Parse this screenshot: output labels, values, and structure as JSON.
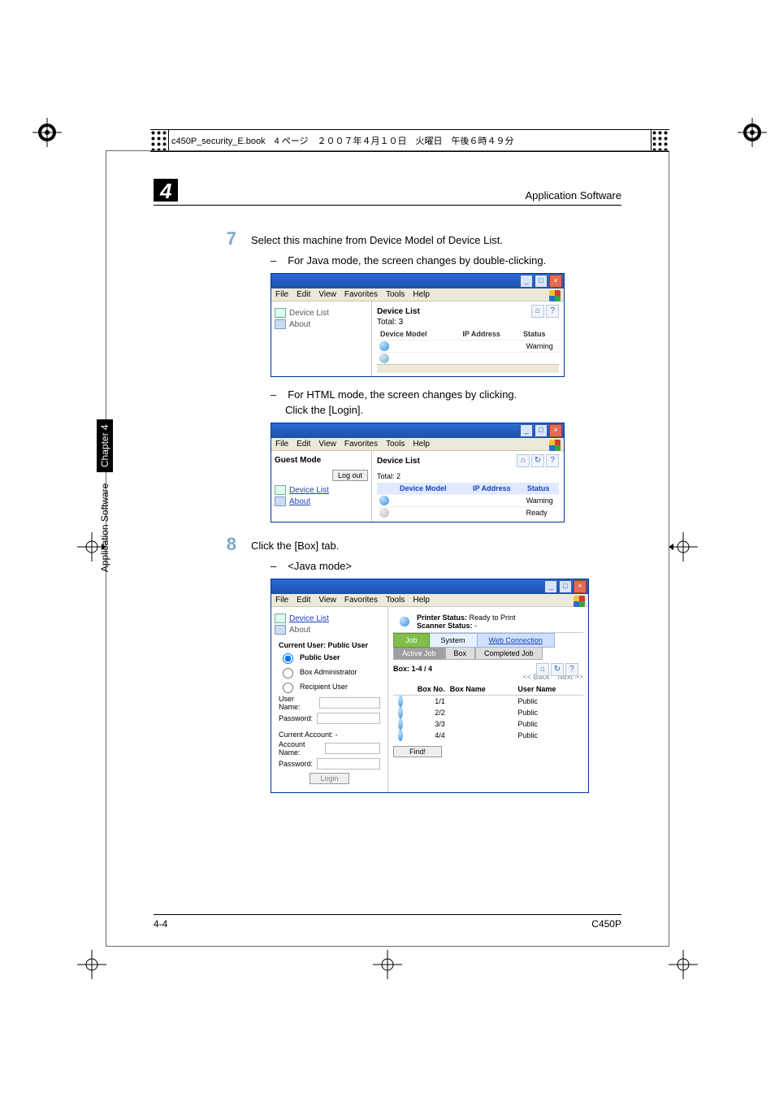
{
  "filmstrip_text": "c450P_security_E.book　4 ページ　２００７年４月１０日　火曜日　午後６時４９分",
  "chapter_number": "4",
  "running_title": "Application Software",
  "side_tab_chapter": "Chapter 4",
  "side_tab_title": "Application Software",
  "footer_left": "4-4",
  "footer_right": "C450P",
  "step7_num": "7",
  "step7_text": "Select this machine from Device Model of Device List.",
  "dash_7a": "For Java mode, the screen changes by double-clicking.",
  "dash_7b": "For HTML mode, the screen changes by clicking.",
  "dash_7b2": "Click the [Login].",
  "step8_num": "8",
  "step8_text": "Click the [Box] tab.",
  "dash_8a": "<Java mode>",
  "menu": {
    "file": "File",
    "edit": "Edit",
    "view": "View",
    "fav": "Favorites",
    "tools": "Tools",
    "help": "Help"
  },
  "winbtn": {
    "min": "_",
    "max": "□",
    "close": "×"
  },
  "win1": {
    "nav_device": "Device List",
    "nav_about": "About",
    "heading": "Device List",
    "total": "Total: 3",
    "hdr_model": "Device Model",
    "hdr_ip": "IP Address",
    "hdr_status": "Status",
    "row_status": "Warning",
    "icon_home": "⌂",
    "icon_help": "?"
  },
  "win2": {
    "guest": "Guest Mode",
    "logout": "Log out",
    "nav_device": "Device List",
    "nav_about": "About",
    "heading": "Device List",
    "total": "Total: 2",
    "hdr_model": "Device Model",
    "hdr_ip": "IP Address",
    "hdr_status": "Status",
    "row1_status": "Warning",
    "row2_status": "Ready",
    "icon_home": "⌂",
    "icon_refresh": "↻",
    "icon_help": "?"
  },
  "win3": {
    "nav_device": "Device List",
    "nav_about": "About",
    "cu_label": "Current User: Public User",
    "rb_public": "Public User",
    "rb_boxadmin": "Box Administrator",
    "rb_recipient": "Recipient User",
    "lbl_username": "User Name:",
    "lbl_password": "Password:",
    "lbl_curacct": "Current Account: -",
    "lbl_acctname": "Account Name:",
    "lbl_password2": "Password:",
    "btn_login": "Login",
    "ps_label": "Printer Status:",
    "ps_val": "Ready to Print",
    "ss_label": "Scanner Status:",
    "ss_val": "-",
    "tab_job": "Job",
    "tab_system": "System",
    "tab_web": "Web Connection",
    "subtab_active": "Active Job",
    "subtab_box": "Box",
    "subtab_completed": "Completed Job",
    "box_counter": "Box: 1-4 / 4",
    "pager_back": "<< Back",
    "pager_next": "Next >>",
    "hdr_boxno": "Box No.",
    "hdr_boxname": "Box Name",
    "hdr_username": "User Name",
    "rows": [
      {
        "no": "1/1",
        "bn": "",
        "un": "Public"
      },
      {
        "no": "2/2",
        "bn": "",
        "un": "Public"
      },
      {
        "no": "3/3",
        "bn": "",
        "un": "Public"
      },
      {
        "no": "4/4",
        "bn": "",
        "un": "Public"
      }
    ],
    "btn_find": "Find!",
    "icon_home": "⌂",
    "icon_refresh": "↻",
    "icon_help": "?"
  }
}
